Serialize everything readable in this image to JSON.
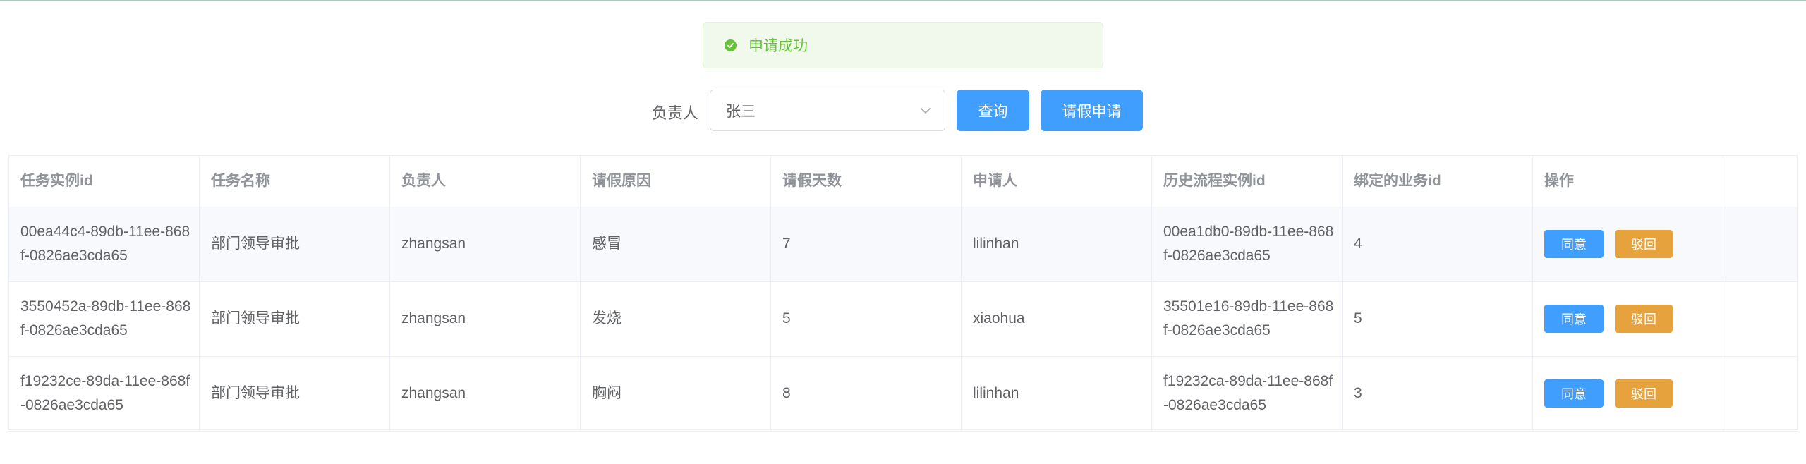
{
  "message": {
    "text": "申请成功"
  },
  "form": {
    "owner_label": "负责人",
    "owner_value": "张三",
    "query_label": "查询",
    "leave_label": "请假申请"
  },
  "table": {
    "headers": [
      "任务实例id",
      "任务名称",
      "负责人",
      "请假原因",
      "请假天数",
      "申请人",
      "历史流程实例id",
      "绑定的业务id",
      "操作"
    ],
    "rows": [
      {
        "task_id": "00ea44c4-89db-11ee-868f-0826ae3cda65",
        "task_name": "部门领导审批",
        "assignee": "zhangsan",
        "reason": "感冒",
        "days": "7",
        "applicant": "lilinhan",
        "hist_id": "00ea1db0-89db-11ee-868f-0826ae3cda65",
        "biz_id": "4",
        "agree": "同意",
        "reject": "驳回"
      },
      {
        "task_id": "3550452a-89db-11ee-868f-0826ae3cda65",
        "task_name": "部门领导审批",
        "assignee": "zhangsan",
        "reason": "发烧",
        "days": "5",
        "applicant": "xiaohua",
        "hist_id": "35501e16-89db-11ee-868f-0826ae3cda65",
        "biz_id": "5",
        "agree": "同意",
        "reject": "驳回"
      },
      {
        "task_id": "f19232ce-89da-11ee-868f-0826ae3cda65",
        "task_name": "部门领导审批",
        "assignee": "zhangsan",
        "reason": "胸闷",
        "days": "8",
        "applicant": "lilinhan",
        "hist_id": "f19232ca-89da-11ee-868f-0826ae3cda65",
        "biz_id": "3",
        "agree": "同意",
        "reject": "驳回"
      }
    ]
  },
  "colors": {
    "primary": "#409eff",
    "success": "#67c23a",
    "warning": "#e6a23c"
  }
}
